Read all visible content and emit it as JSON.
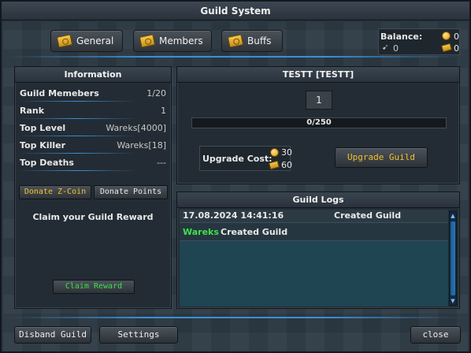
{
  "window": {
    "title": "Guild System"
  },
  "tabs": [
    {
      "label": "General",
      "icon": "ticket-icon"
    },
    {
      "label": "Members",
      "icon": "ticket-icon"
    },
    {
      "label": "Buffs",
      "icon": "ticket-icon"
    }
  ],
  "balance": {
    "label": "Balance:",
    "coins": "0",
    "tickets": "0",
    "reward_points": "0",
    "extra": "0"
  },
  "information": {
    "title": "Information",
    "rows": [
      {
        "label": "Guild Memebers",
        "value": "1/20"
      },
      {
        "label": "Rank",
        "value": "1"
      },
      {
        "label": "Top Level",
        "value": "Wareks[4000]"
      },
      {
        "label": "Top Killer",
        "value": "Wareks[18]"
      },
      {
        "label": "Top Deaths",
        "value": "---"
      }
    ],
    "donate_zcoin_label": "Donate Z-Coin",
    "donate_points_label": "Donate Points",
    "claim_text": "Claim your Guild Reward",
    "claim_button_label": "Claim Reward"
  },
  "guild": {
    "name": "TESTT [TESTT]",
    "level": "1",
    "progress_text": "0/250",
    "progress_fraction": 0,
    "upgrade_cost_label": "Upgrade Cost:",
    "upgrade_cost_coins": "30",
    "upgrade_cost_tickets": "60",
    "upgrade_button_label": "Upgrade Guild"
  },
  "logs": {
    "title": "Guild Logs",
    "header_date": "17.08.2024 14:41:16",
    "header_action": "Created Guild",
    "entries": [
      {
        "player": "Wareks",
        "text": "Created Guild"
      }
    ]
  },
  "footer": {
    "disband_label": "Disband Guild",
    "settings_label": "Settings",
    "close_label": "close"
  },
  "colors": {
    "accent_blue": "#3a8fd8",
    "gold_text": "#f2c12e",
    "green_text": "#3ee04a"
  }
}
